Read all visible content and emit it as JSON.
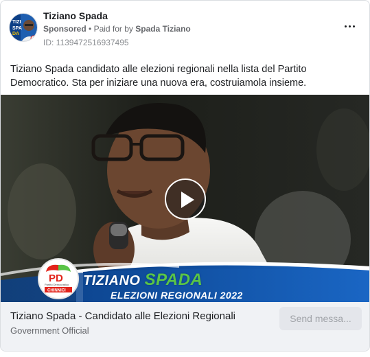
{
  "header": {
    "page_name": "Tiziano Spada",
    "sponsored": "Sponsored",
    "separator": "•",
    "paid_for_prefix": "Paid for by",
    "paid_for_by": "Spada Tiziano",
    "ad_id": "ID: 1139472516937495",
    "more_icon": "more-horizontal-icon"
  },
  "post": {
    "text": "Tiziano Spada candidato alle elezioni regionali nella lista del Partito Democratico. Sta per iniziare una nuova era, costruiamola insieme."
  },
  "media": {
    "type": "video",
    "play_icon": "play-icon",
    "banner": {
      "first_name": "TIZIANO",
      "last_name": "SPADA",
      "subtitle": "ELEZIONI REGIONALI 2022",
      "logo_text": "PD",
      "logo_caption": "Partito Democratico",
      "logo_sub": "CHINNICI"
    }
  },
  "footer": {
    "headline": "Tiziano Spada - Candidato alle Elezioni Regionali",
    "subline": "Government Official",
    "cta_label": "Send messa..."
  },
  "colors": {
    "banner_blue": "#0d4c9a",
    "pd_green": "#5ac447",
    "pd_red": "#e2231a",
    "footer_bg": "#f0f2f5",
    "cta_bg": "#e4e6eb"
  }
}
